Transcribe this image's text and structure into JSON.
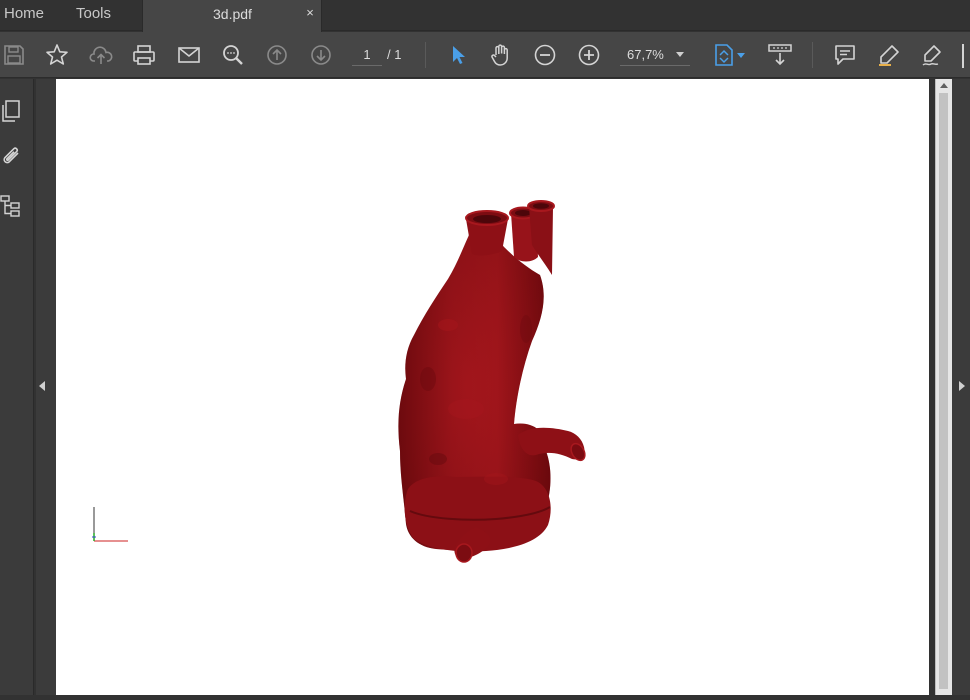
{
  "tabs": {
    "home": "Home",
    "tools": "Tools",
    "document": "3d.pdf",
    "close_symbol": "×"
  },
  "toolbar": {
    "icons": [
      "save-icon",
      "bookmark-star-icon",
      "cloud-upload-icon",
      "print-icon",
      "email-icon",
      "search-icon",
      "previous-page-icon",
      "next-page-icon",
      "select-pointer-icon",
      "hand-tool-icon",
      "zoom-out-icon",
      "zoom-in-icon",
      "fit-page-icon",
      "scroll-mode-icon",
      "comment-icon",
      "highlight-icon",
      "sign-icon"
    ],
    "current_page": "1",
    "total_pages": "/ 1",
    "zoom": "67,7%"
  },
  "sidebar": {
    "icons": [
      "pages-thumbnail-icon",
      "attachment-icon",
      "model-tree-icon"
    ]
  },
  "colors": {
    "accent": "#4a9fe8",
    "model": "#8e1015",
    "chrome_dark": "#323232",
    "toolbar": "#464646"
  }
}
